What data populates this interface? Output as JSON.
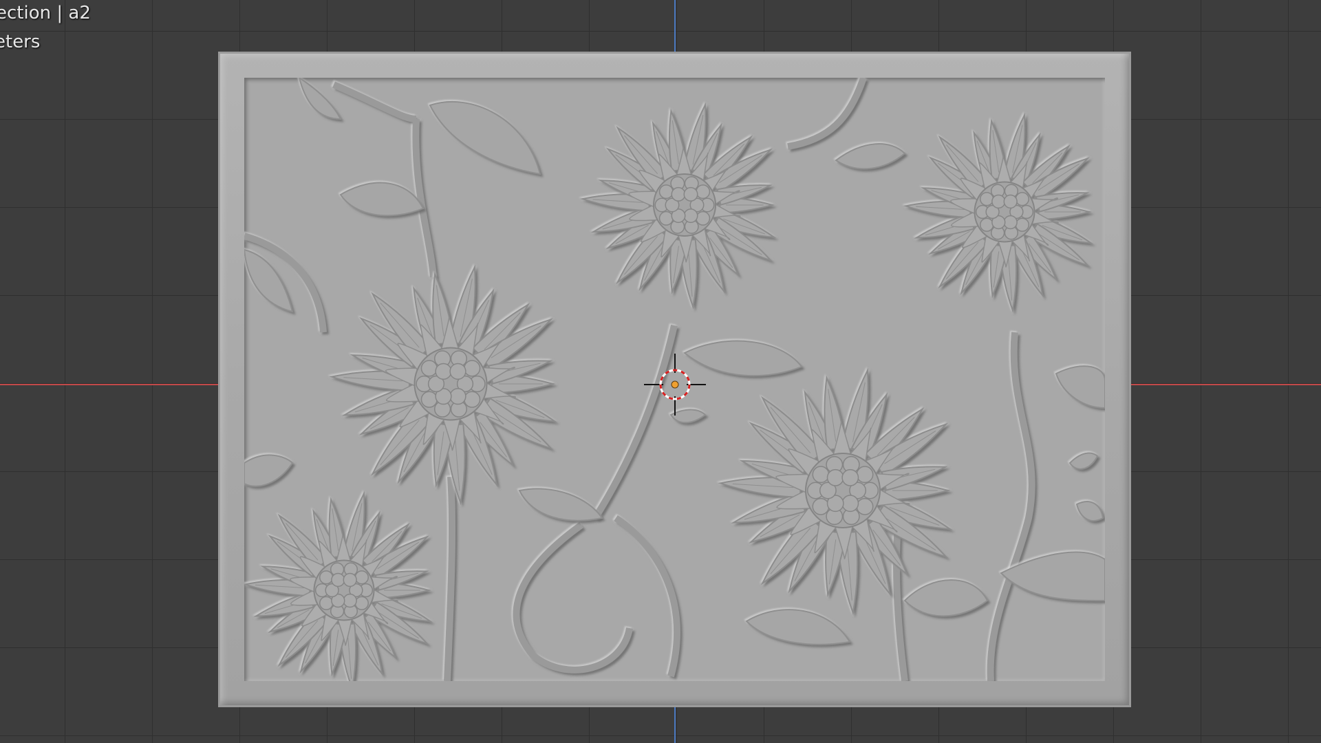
{
  "viewport": {
    "overlay_line1": "ection | a2",
    "overlay_line2": "eters"
  },
  "scene": {
    "object_description": "sunflower",
    "cursor": "3d-cursor-icon"
  },
  "colors": {
    "background": "#3d3d3d",
    "grid": "#2f2f2f",
    "x_axis": "#c24a4a",
    "y_axis": "#4a78c0",
    "relief": "#a8a8a8",
    "origin": "#f0a030"
  }
}
